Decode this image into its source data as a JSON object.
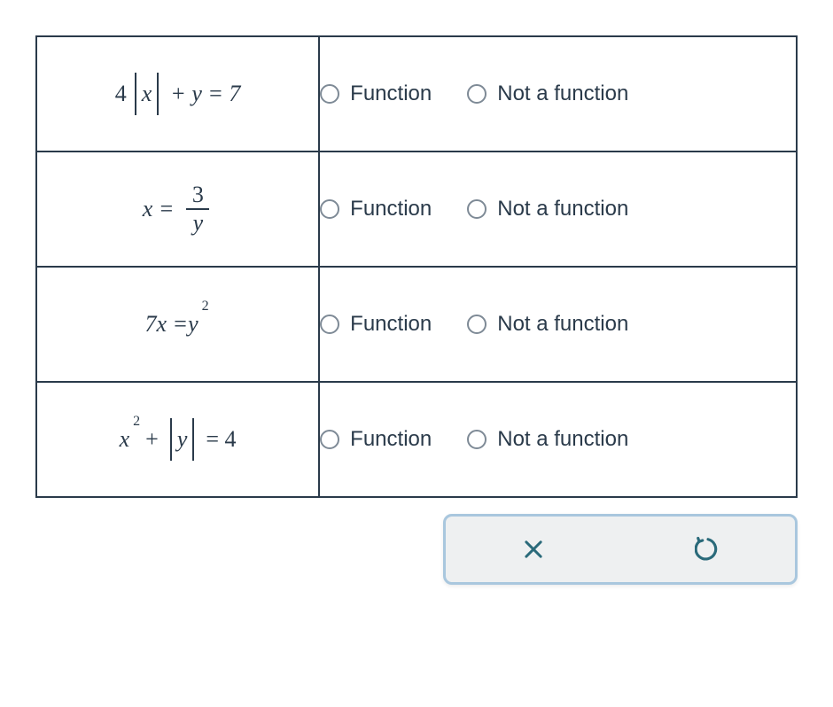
{
  "options": {
    "function": "Function",
    "not_function": "Not a function"
  },
  "rows": [
    {
      "eq": {
        "coef": "4",
        "abs_var": "x",
        "rest": "+ y = 7"
      }
    },
    {
      "eq": {
        "lhs": "x =",
        "num": "3",
        "den": "y"
      }
    },
    {
      "eq": {
        "lhs": "7x = ",
        "base": "y",
        "sup": "2"
      }
    },
    {
      "eq": {
        "base": "x",
        "sup": "2",
        "plus": "+",
        "abs_var": "y",
        "rest": "= 4"
      }
    }
  ],
  "icons": {
    "close": "close-icon",
    "undo": "undo-icon"
  }
}
